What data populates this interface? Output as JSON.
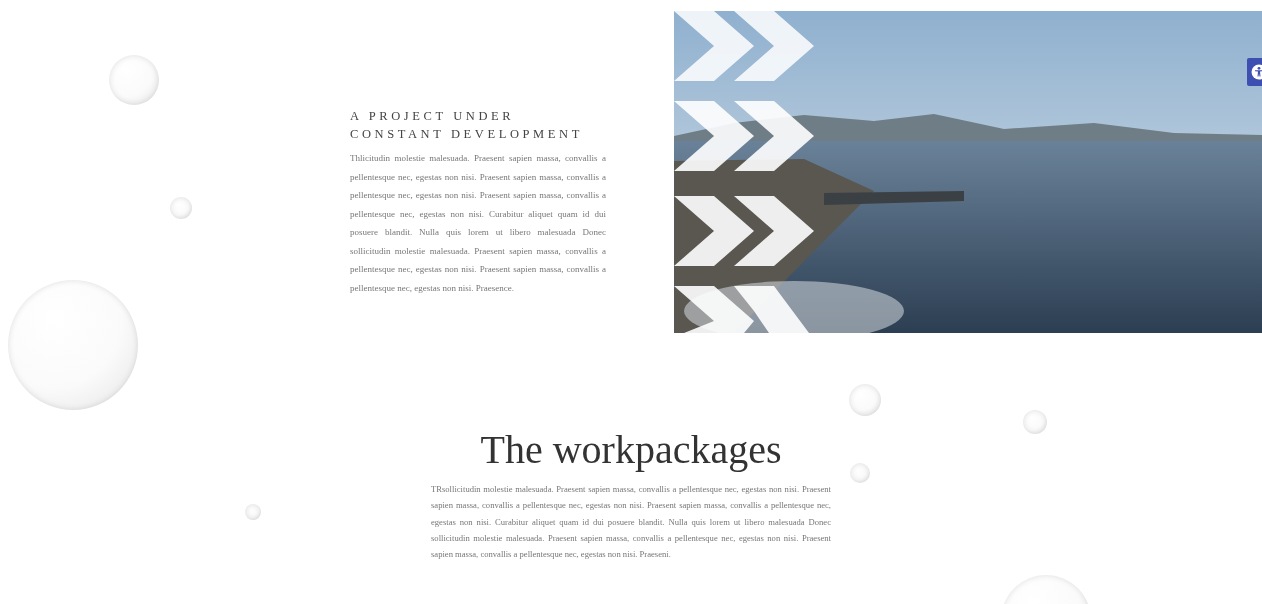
{
  "intro": {
    "heading": "A PROJECT UNDER CONSTANT DEVELOPMENT",
    "text": "Thlicitudin molestie malesuada. Praesent sapien massa, convallis a pellentesque nec, egestas non nisi. Praesent sapien massa, convallis a pellentesque nec, egestas non nisi. Praesent sapien massa, convallis a pellentesque nec, egestas non nisi. Curabitur aliquet quam id dui posuere blandit. Nulla quis lorem ut libero malesuada Donec sollicitudin molestie malesuada. Praesent sapien massa, convallis a pellentesque nec, egestas non nisi. Praesent sapien massa, convallis a pellentesque nec, egestas non nisi. Praesence."
  },
  "workpackages": {
    "title": "The workpackages",
    "text": "TRsollicitudin molestie malesuada. Praesent sapien massa, convallis a pellentesque nec, egestas non nisi. Praesent sapien massa, convallis a pellentesque nec, egestas non nisi. Praesent sapien massa, convallis a pellentesque nec, egestas non nisi. Curabitur aliquet quam id dui posuere blandit. Nulla quis lorem ut libero malesuada Donec sollicitudin molestie malesuada. Praesent sapien massa, convallis a pellentesque nec, egestas non nisi. Praesent sapien massa, convallis a pellentesque nec, egestas non nisi. Praeseni."
  }
}
